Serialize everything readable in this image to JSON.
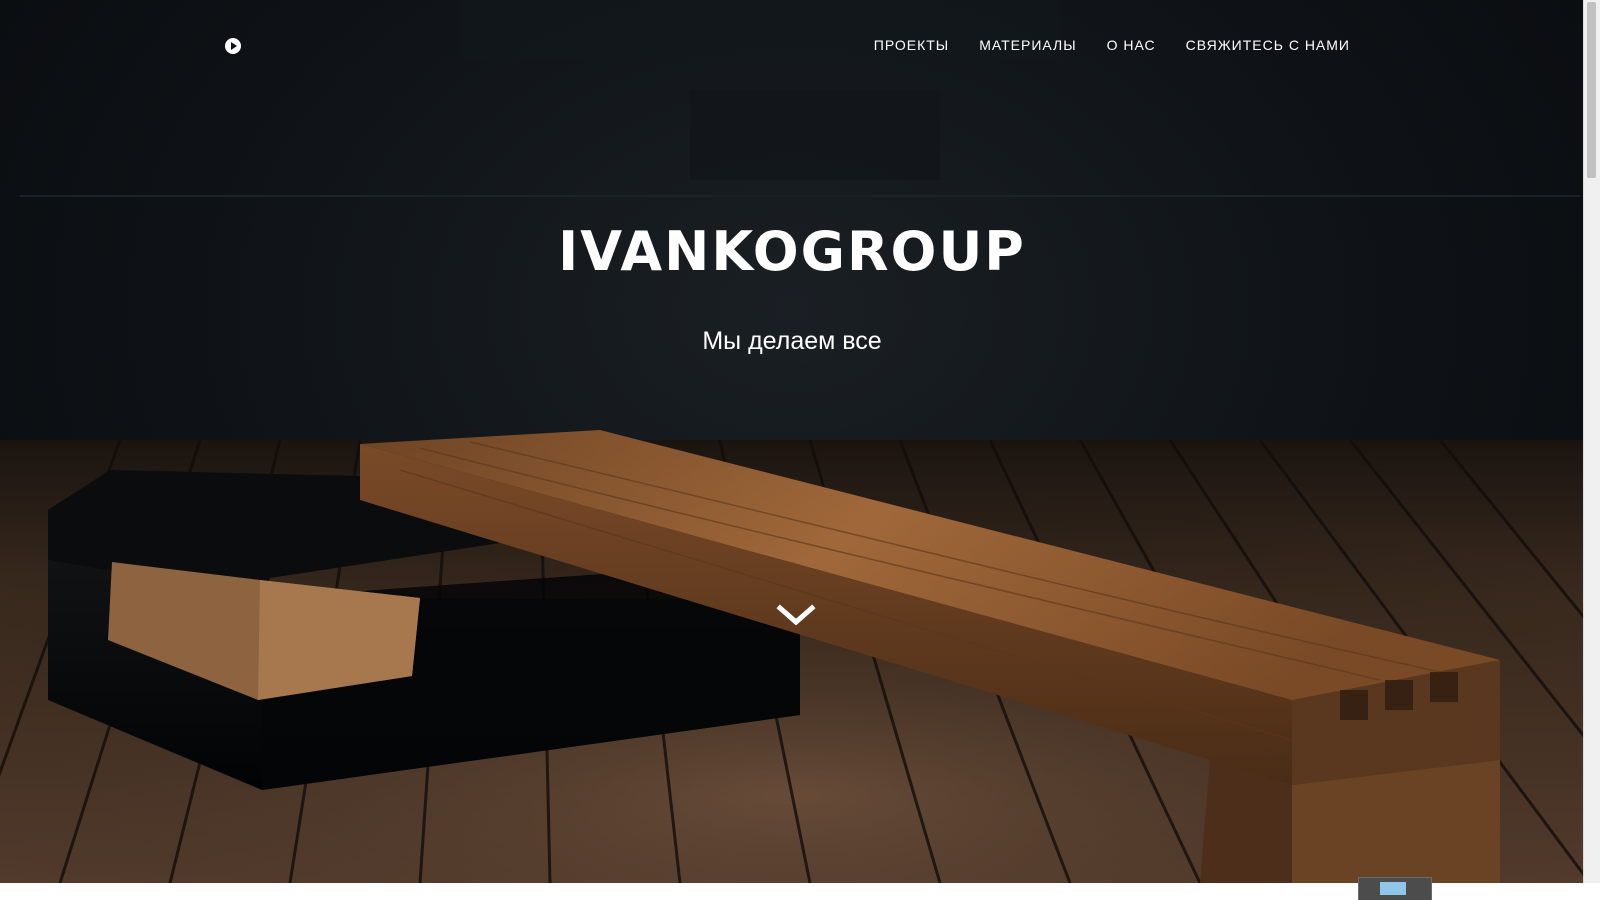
{
  "nav": {
    "logo_icon": "play-circle-icon",
    "links": [
      {
        "label": "ПРОЕКТЫ"
      },
      {
        "label": "МАТЕРИАЛЫ"
      },
      {
        "label": "О НАС"
      },
      {
        "label": "СВЯЖИТЕСЬ С НАМИ"
      }
    ]
  },
  "hero": {
    "title": "IVANKOGROUP",
    "tagline": "Мы делаем все",
    "scroll_icon": "chevron-down-icon"
  },
  "colors": {
    "background": "#0c1014",
    "text": "#ffffff",
    "wood": "#8a5a30",
    "floor": "#4a3424"
  }
}
